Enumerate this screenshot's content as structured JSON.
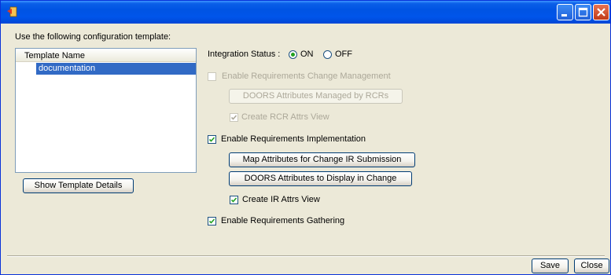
{
  "window": {
    "title": ""
  },
  "template_section": {
    "prompt": "Use the following configuration template:",
    "column_header": "Template Name",
    "items": [
      "documentation"
    ],
    "show_details_button": "Show Template Details"
  },
  "integration": {
    "label": "Integration Status :",
    "on_label": "ON",
    "off_label": "OFF",
    "selected": "ON"
  },
  "change_mgmt": {
    "label": "Enable Requirements Change Management",
    "checked": false,
    "enabled": false,
    "attrs_button": "DOORS Attributes Managed by RCRs",
    "view_label": "Create RCR Attrs View",
    "view_checked": true
  },
  "implementation": {
    "label": "Enable Requirements Implementation",
    "checked": true,
    "map_button": "Map Attributes for Change IR Submission",
    "display_button": "DOORS Attributes to Display in Change",
    "view_label": "Create IR Attrs View",
    "view_checked": true
  },
  "gathering": {
    "label": "Enable Requirements Gathering",
    "checked": true
  },
  "footer": {
    "save_label": "Save",
    "close_label": "Close"
  },
  "colors": {
    "accent_selection": "#316AC5",
    "titlebar": "#0054E3",
    "radio_dot": "#21A121"
  }
}
